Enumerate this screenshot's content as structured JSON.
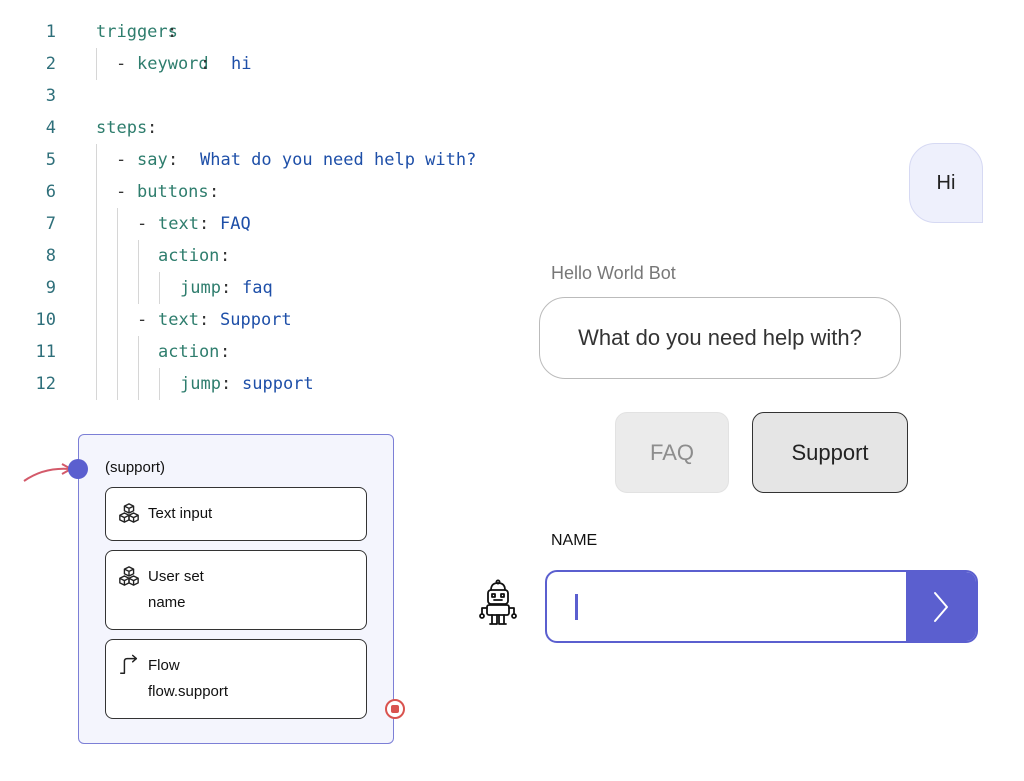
{
  "code_editor": {
    "lines": [
      {
        "n": "1",
        "indent": 0,
        "key": "triggers",
        "sep": ":",
        "value": ""
      },
      {
        "n": "2",
        "indent": 1,
        "dash": true,
        "key": "keyword",
        "sep": ": ",
        "value": "hi"
      },
      {
        "n": "3",
        "indent": 0,
        "key": "",
        "sep": "",
        "value": ""
      },
      {
        "n": "4",
        "indent": 0,
        "key": "steps",
        "sep": ":",
        "value": ""
      },
      {
        "n": "5",
        "indent": 1,
        "dash": true,
        "key": "say",
        "sep": ":  ",
        "value": "What do you need help with?"
      },
      {
        "n": "6",
        "indent": 1,
        "dash": true,
        "key": "buttons",
        "sep": ":",
        "value": ""
      },
      {
        "n": "7",
        "indent": 2,
        "dash": true,
        "key": "text",
        "sep": ": ",
        "value": "FAQ"
      },
      {
        "n": "8",
        "indent": 3,
        "key": "action",
        "sep": ":",
        "value": ""
      },
      {
        "n": "9",
        "indent": 4,
        "key": "jump",
        "sep": ": ",
        "value": "faq"
      },
      {
        "n": "10",
        "indent": 2,
        "dash": true,
        "key": "text",
        "sep": ": ",
        "value": "Support"
      },
      {
        "n": "11",
        "indent": 3,
        "key": "action",
        "sep": ":",
        "value": ""
      },
      {
        "n": "12",
        "indent": 4,
        "key": "jump",
        "sep": ": ",
        "value": "support"
      }
    ]
  },
  "flow": {
    "title": "(support)",
    "steps": [
      {
        "icon": "cubes-icon",
        "label": "Text input",
        "sub": ""
      },
      {
        "icon": "cubes-icon",
        "label": "User set",
        "sub": "name"
      },
      {
        "icon": "flow-arrow-icon",
        "label": "Flow",
        "sub": "flow.support"
      }
    ]
  },
  "chat": {
    "user_message": "Hi",
    "bot_name": "Hello World Bot",
    "bot_message": "What do you need help with?",
    "buttons": [
      {
        "label": "FAQ",
        "state": "disabled"
      },
      {
        "label": "Support",
        "state": "selected"
      }
    ],
    "input_label": "NAME",
    "input_value": "",
    "send_icon": "chevron-right-icon",
    "bot_avatar_icon": "robot-icon"
  },
  "colors": {
    "accent": "#5b5fcf",
    "code_key": "#2e7d6d",
    "code_value": "#1e4fa8",
    "end_dot": "#d9534f",
    "node_bg": "#f4f5fd"
  }
}
